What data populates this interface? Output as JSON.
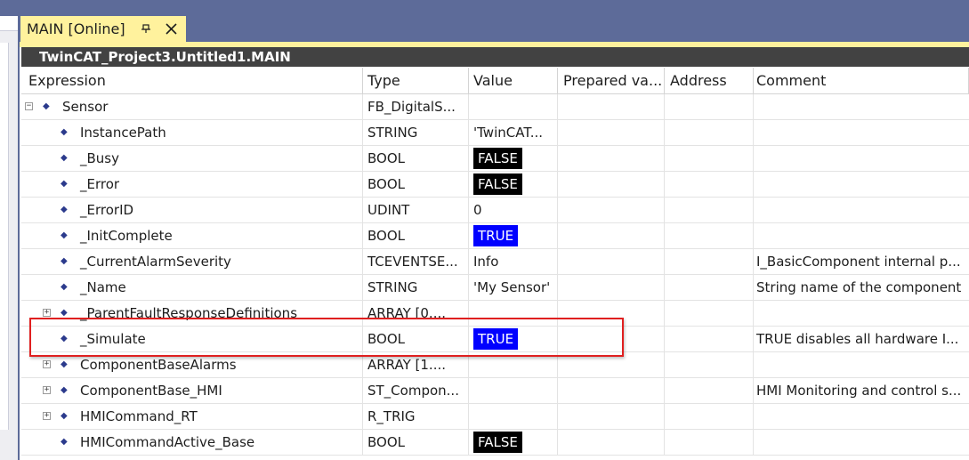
{
  "tab": {
    "title": "MAIN [Online]",
    "pin_icon": "pin-icon",
    "close_icon": "close-icon"
  },
  "path_bar": "TwinCAT_Project3.Untitled1.MAIN",
  "columns": {
    "expression": "Expression",
    "type": "Type",
    "value": "Value",
    "prepared": "Prepared va...",
    "address": "Address",
    "comment": "Comment"
  },
  "rows": [
    {
      "name": "Sensor",
      "type": "FB_DigitalS...",
      "value": "",
      "comment": "",
      "expand": "collapse",
      "indent": 0
    },
    {
      "name": "InstancePath",
      "type": "STRING",
      "value": "'TwinCAT...",
      "comment": "",
      "expand": "",
      "indent": 1
    },
    {
      "name": "_Busy",
      "type": "BOOL",
      "value": "FALSE",
      "value_style": "false",
      "comment": "",
      "expand": "",
      "indent": 1
    },
    {
      "name": "_Error",
      "type": "BOOL",
      "value": "FALSE",
      "value_style": "false",
      "comment": "",
      "expand": "",
      "indent": 1
    },
    {
      "name": "_ErrorID",
      "type": "UDINT",
      "value": "0",
      "comment": "",
      "expand": "",
      "indent": 1
    },
    {
      "name": "_InitComplete",
      "type": "BOOL",
      "value": "TRUE",
      "value_style": "true",
      "comment": "",
      "expand": "",
      "indent": 1
    },
    {
      "name": "_CurrentAlarmSeverity",
      "type": "TCEVENTSE...",
      "value": "Info",
      "comment": "I_BasicComponent internal p...",
      "expand": "",
      "indent": 1
    },
    {
      "name": "_Name",
      "type": "STRING",
      "value": "'My Sensor'",
      "comment": "String name of the component",
      "expand": "",
      "indent": 1
    },
    {
      "name": "_ParentFaultResponseDefinitions",
      "type": "ARRAY [0....",
      "value": "",
      "comment": "",
      "expand": "expand",
      "indent": 1
    },
    {
      "name": "_Simulate",
      "type": "BOOL",
      "value": "TRUE",
      "value_style": "true",
      "comment": "TRUE disables all hardware I...",
      "expand": "",
      "indent": 1
    },
    {
      "name": "ComponentBaseAlarms",
      "type": "ARRAY [1....",
      "value": "",
      "comment": "",
      "expand": "expand",
      "indent": 1
    },
    {
      "name": "ComponentBase_HMI",
      "type": "ST_Compon...",
      "value": "",
      "comment": "HMI Monitoring and control s...",
      "expand": "expand",
      "indent": 1
    },
    {
      "name": "HMICommand_RT",
      "type": "R_TRIG",
      "value": "",
      "comment": "",
      "expand": "expand",
      "indent": 1
    },
    {
      "name": "HMICommandActive_Base",
      "type": "BOOL",
      "value": "FALSE",
      "value_style": "false",
      "comment": "",
      "expand": "",
      "indent": 1
    }
  ],
  "colors": {
    "tab_strip": "#5d6b99",
    "active_tab": "#fff29d",
    "path_bar": "#424242",
    "true_badge": "#0000ff",
    "false_badge": "#000000",
    "highlight": "#e02020"
  },
  "highlighted_row": "_Simulate"
}
